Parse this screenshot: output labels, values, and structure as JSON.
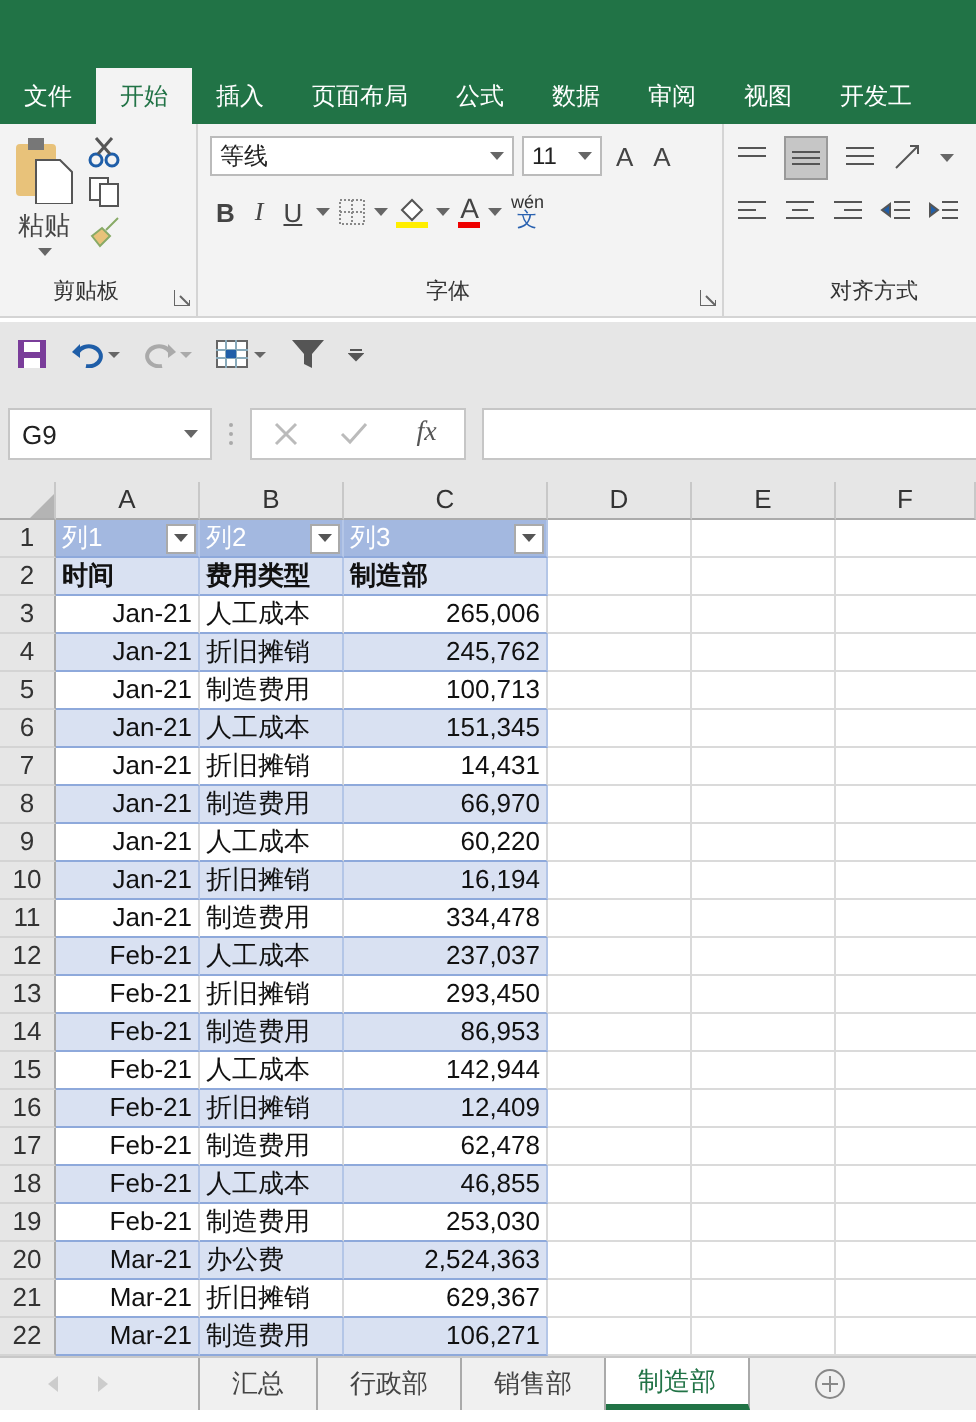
{
  "ribbon_tabs": [
    {
      "label": "文件",
      "selected": false
    },
    {
      "label": "开始",
      "selected": true
    },
    {
      "label": "插入",
      "selected": false
    },
    {
      "label": "页面布局",
      "selected": false
    },
    {
      "label": "公式",
      "selected": false
    },
    {
      "label": "数据",
      "selected": false
    },
    {
      "label": "审阅",
      "selected": false
    },
    {
      "label": "视图",
      "selected": false
    },
    {
      "label": "开发工",
      "selected": false
    }
  ],
  "clipboard": {
    "paste": "粘贴",
    "label": "剪贴板"
  },
  "font": {
    "name": "等线",
    "size": "11",
    "grow": "A",
    "shrink": "A",
    "bold": "B",
    "italic": "I",
    "underline": "U",
    "font_color": "A",
    "phonetic": [
      "wén",
      "文"
    ],
    "label": "字体"
  },
  "alignment": {
    "label": "对齐方式"
  },
  "name_box": "G9",
  "formula_bar": {
    "fx": "fx"
  },
  "columns": [
    "A",
    "B",
    "C",
    "D",
    "E",
    "F"
  ],
  "row_numbers": [
    "1",
    "2",
    "3",
    "4",
    "5",
    "6",
    "7",
    "8",
    "9",
    "10",
    "11",
    "12",
    "13",
    "14",
    "15",
    "16",
    "17",
    "18",
    "19",
    "20",
    "21",
    "22"
  ],
  "table": {
    "headers": [
      "列1",
      "列2",
      "列3"
    ],
    "rows": [
      {
        "kind": "heading",
        "cells": [
          "时间",
          "费用类型",
          "制造部"
        ]
      },
      {
        "kind": "data",
        "cells": [
          "Jan-21",
          "人工成本",
          "265,006"
        ]
      },
      {
        "kind": "data",
        "cells": [
          "Jan-21",
          "折旧摊销",
          "245,762"
        ]
      },
      {
        "kind": "data",
        "cells": [
          "Jan-21",
          "制造费用",
          "100,713"
        ]
      },
      {
        "kind": "data",
        "cells": [
          "Jan-21",
          "人工成本",
          "151,345"
        ]
      },
      {
        "kind": "data",
        "cells": [
          "Jan-21",
          "折旧摊销",
          "14,431"
        ]
      },
      {
        "kind": "data",
        "cells": [
          "Jan-21",
          "制造费用",
          "66,970"
        ]
      },
      {
        "kind": "data",
        "cells": [
          "Jan-21",
          "人工成本",
          "60,220"
        ]
      },
      {
        "kind": "data",
        "cells": [
          "Jan-21",
          "折旧摊销",
          "16,194"
        ]
      },
      {
        "kind": "data",
        "cells": [
          "Jan-21",
          "制造费用",
          "334,478"
        ]
      },
      {
        "kind": "data",
        "cells": [
          "Feb-21",
          "人工成本",
          "237,037"
        ]
      },
      {
        "kind": "data",
        "cells": [
          "Feb-21",
          "折旧摊销",
          "293,450"
        ]
      },
      {
        "kind": "data",
        "cells": [
          "Feb-21",
          "制造费用",
          "86,953"
        ]
      },
      {
        "kind": "data",
        "cells": [
          "Feb-21",
          "人工成本",
          "142,944"
        ]
      },
      {
        "kind": "data",
        "cells": [
          "Feb-21",
          "折旧摊销",
          "12,409"
        ]
      },
      {
        "kind": "data",
        "cells": [
          "Feb-21",
          "制造费用",
          "62,478"
        ]
      },
      {
        "kind": "data",
        "cells": [
          "Feb-21",
          "人工成本",
          "46,855"
        ]
      },
      {
        "kind": "data",
        "cells": [
          "Feb-21",
          "制造费用",
          "253,030"
        ]
      },
      {
        "kind": "data",
        "cells": [
          "Mar-21",
          "办公费",
          "2,524,363"
        ]
      },
      {
        "kind": "data",
        "cells": [
          "Mar-21",
          "折旧摊销",
          "629,367"
        ]
      },
      {
        "kind": "data",
        "cells": [
          "Mar-21",
          "制造费用",
          "106,271"
        ]
      }
    ]
  },
  "sheet_tabs": [
    {
      "label": "汇总",
      "selected": false
    },
    {
      "label": "行政部",
      "selected": false
    },
    {
      "label": "销售部",
      "selected": false
    },
    {
      "label": "制造部",
      "selected": true
    }
  ]
}
